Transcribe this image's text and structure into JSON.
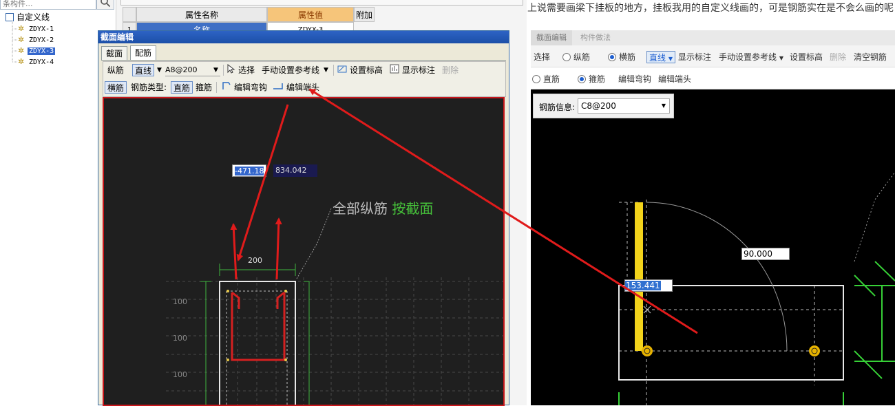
{
  "tree": {
    "search_placeholder": "条构件...",
    "root_label": "自定义线",
    "items": [
      {
        "label": "ZDYX-1"
      },
      {
        "label": "ZDYX-2"
      },
      {
        "label": "ZDYX-3"
      },
      {
        "label": "ZDYX-4"
      }
    ]
  },
  "prop_grid": {
    "header_name": "属性名称",
    "header_value": "属性值",
    "header_extra": "附加",
    "row1_index": "1",
    "row1_name": "名称",
    "row1_value": "ZDYX-3"
  },
  "dialog": {
    "title": "截面编辑",
    "tabs": [
      "截面",
      "配筋"
    ],
    "toolbar1": {
      "longitudinal": "纵筋",
      "line_mode": "直线",
      "rebar_value": "A8@200",
      "select": "选择",
      "manual_ref": "手动设置参考线",
      "set_elev": "设置标高",
      "show_label": "显示标注",
      "delete": "删除"
    },
    "toolbar2": {
      "transverse": "横筋",
      "rebar_type_label": "钢筋类型:",
      "straight": "直筋",
      "stirrup": "箍筋",
      "edit_hook": "编辑弯钩",
      "edit_end": "编辑端头"
    },
    "canvas": {
      "coord_x": "-471.18",
      "coord_y": "834.042",
      "note_gray": "全部纵筋",
      "note_green": "按截面",
      "dim_width": "200",
      "dim_rows": [
        "100",
        "100",
        "100"
      ]
    }
  },
  "right": {
    "question": "上说需要画梁下挂板的地方，挂板我用的自定义线画的，可是钢筋实在是不会么画的呢",
    "tabs": [
      "截面编辑",
      "构件做法"
    ],
    "toolbar1": {
      "select": "选择",
      "longitudinal": "纵筋",
      "transverse": "横筋",
      "line": "直线",
      "show_label": "显示标注",
      "manual_ref": "手动设置参考线",
      "set_elev": "设置标高",
      "delete": "删除",
      "clear": "清空钢筋"
    },
    "toolbar2": {
      "straight": "直筋",
      "stirrup": "箍筋",
      "edit_hook": "编辑弯钩",
      "edit_end": "编辑端头"
    },
    "info": {
      "label": "钢筋信息:",
      "value": "C8@200"
    },
    "canvas": {
      "angle": "90.000",
      "length": "153.441"
    }
  }
}
